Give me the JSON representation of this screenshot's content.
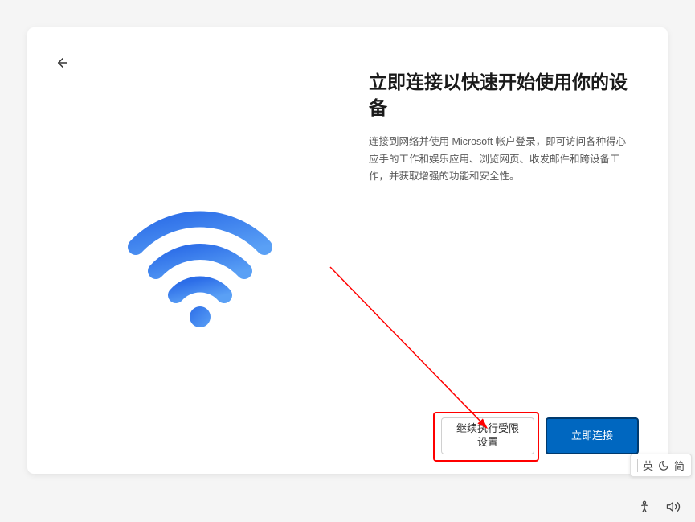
{
  "header": {
    "title": "立即连接以快速开始使用你的设备",
    "description": "连接到网络并使用 Microsoft 帐户登录，即可访问各种得心应手的工作和娱乐应用、浏览网页、收发邮件和跨设备工作，并获取增强的功能和安全性。"
  },
  "buttons": {
    "secondary": "继续执行受限设置",
    "primary": "立即连接"
  },
  "ime": {
    "lang": "英",
    "mode": "简"
  },
  "colors": {
    "primary_button_bg": "#0067c0",
    "primary_button_border": "#003a6e",
    "annotation": "#ff0000",
    "wifi_gradient_start": "#2c6de8",
    "wifi_gradient_end": "#4a8ff0"
  }
}
